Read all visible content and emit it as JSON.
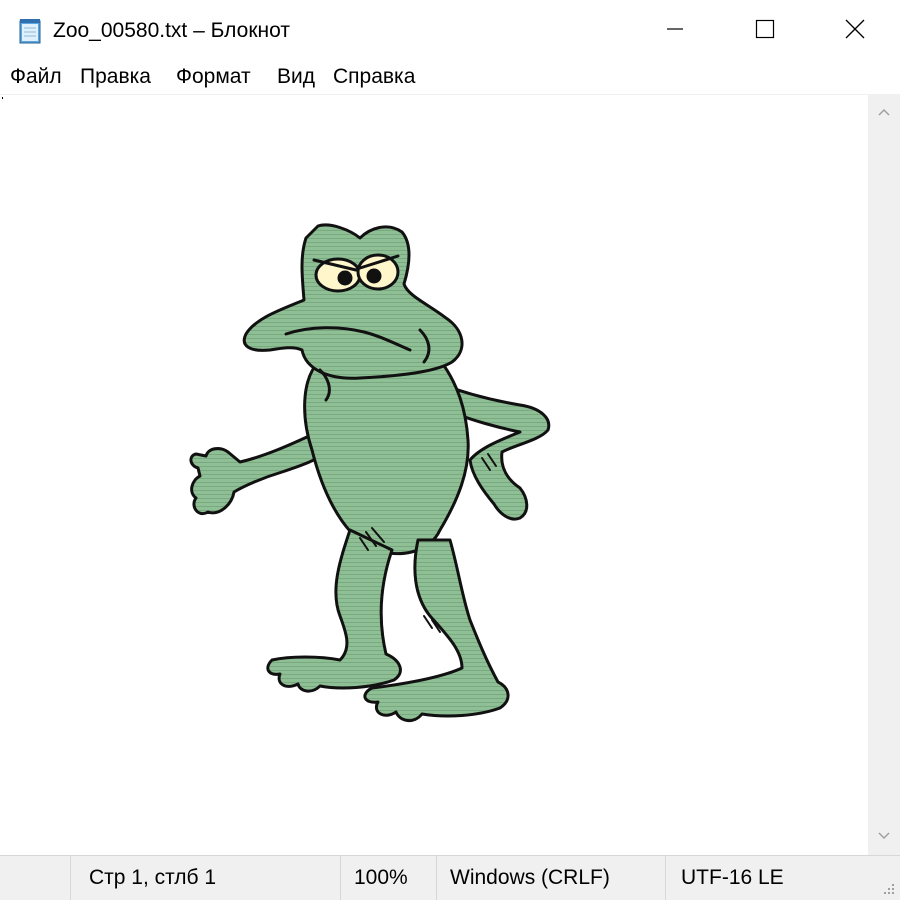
{
  "window": {
    "title": "Zoo_00580.txt – Блокнот",
    "icon": "notepad-icon"
  },
  "controls": {
    "minimize_icon": "minimize-icon",
    "maximize_icon": "maximize-icon",
    "close_icon": "close-icon"
  },
  "menu": {
    "file": "Файл",
    "edit": "Правка",
    "format": "Формат",
    "view": "Вид",
    "help": "Справка"
  },
  "content": {
    "picture": "frog-ascii-art",
    "frog_color": "#8fbf94"
  },
  "scrollbar": {
    "up_icon": "chevron-up-icon",
    "down_icon": "chevron-down-icon"
  },
  "status": {
    "position": "Стр 1, стлб 1",
    "zoom": "100%",
    "line_endings": "Windows (CRLF)",
    "encoding": "UTF-16 LE"
  }
}
